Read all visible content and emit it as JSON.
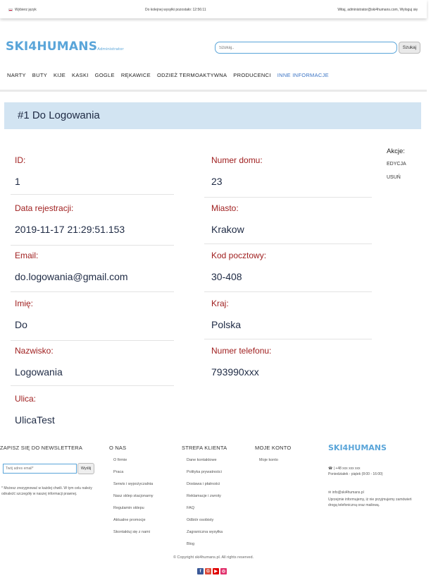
{
  "topbar": {
    "language": "Wybierz język",
    "session": "Do kolejnej wysyłki pozostało: 12:56:11",
    "welcome": "Witaj, administrator@ski4humans.com, Wyloguj się"
  },
  "header": {
    "logo": "SKI4HUMANS",
    "logo_sub": "Administrator",
    "search_placeholder": "Szukaj..",
    "search_button": "Szukaj"
  },
  "nav": [
    "NARTY",
    "BUTY",
    "KIJE",
    "KASKI",
    "GOGLE",
    "RĘKAWICE",
    "ODZIEŻ TERMOAKTYWNA",
    "PRODUCENCI",
    "INNE INFORMACJE"
  ],
  "title": "#1 Do Logowania",
  "fields_left": [
    {
      "label": "ID:",
      "value": "1"
    },
    {
      "label": "Data rejestracji:",
      "value": "2019-11-17 21:29:51.153"
    },
    {
      "label": "Email:",
      "value": "do.logowania@gmail.com"
    },
    {
      "label": "Imię:",
      "value": "Do"
    },
    {
      "label": "Nazwisko:",
      "value": "Logowania"
    },
    {
      "label": "Ulica:",
      "value": "UlicaTest"
    }
  ],
  "fields_right": [
    {
      "label": "Numer domu:",
      "value": "23"
    },
    {
      "label": "Miasto:",
      "value": "Krakow"
    },
    {
      "label": "Kod pocztowy:",
      "value": "30-408"
    },
    {
      "label": "Kraj:",
      "value": "Polska"
    },
    {
      "label": "Numer telefonu:",
      "value": "793990xxx"
    }
  ],
  "actions": {
    "heading": "Akcje:",
    "edit": "EDYCJA",
    "delete": "USUŃ"
  },
  "footer": {
    "newsletter": {
      "heading": "ZAPISZ SIĘ DO NEWSLETTERA",
      "placeholder": "Twój adres email*",
      "button": "Wyślij",
      "note": "* Możesz zrezygnować w każdej chwili. W tym celu należy odnaleźć szczegóły w naszej informacji prawnej."
    },
    "about": {
      "heading": "O NAS",
      "items": [
        "O firmie",
        "Praca",
        "Serwis i wypożyczalnia",
        "Nasz sklep stacjonarny",
        "Regulamin sklepu",
        "Aktualne promocje",
        "Skontaktuj się z nami"
      ]
    },
    "client": {
      "heading": "STREFA KLIENTA",
      "items": [
        "Dane kontaktowe",
        "Polityka prywatności",
        "Dostawa i płatności",
        "Reklamacje i zwroty",
        "FAQ",
        "Odbiór osobisty",
        "Zagraniczna wysyłka",
        "Blog"
      ]
    },
    "account": {
      "heading": "MOJE KONTO",
      "items": [
        "Moje konto"
      ]
    },
    "brand": "SKI4HUMANS",
    "phone": "| +48 xxx xxx xxx",
    "hours": "Poniedziałek - piątek (8:00 - 16:00)",
    "email": "info@ski4humans.pl",
    "email_note": "Uprzejmie informujemy, iż nie przyjmujemy zamówień drogą telefoniczną oraz mailową.",
    "copyright": "© Copyright ski4humans.pl. All rights reserved."
  },
  "colors": {
    "accent": "#5aa5d9",
    "label": "#a02020",
    "title_bg": "#d2e4f2"
  }
}
